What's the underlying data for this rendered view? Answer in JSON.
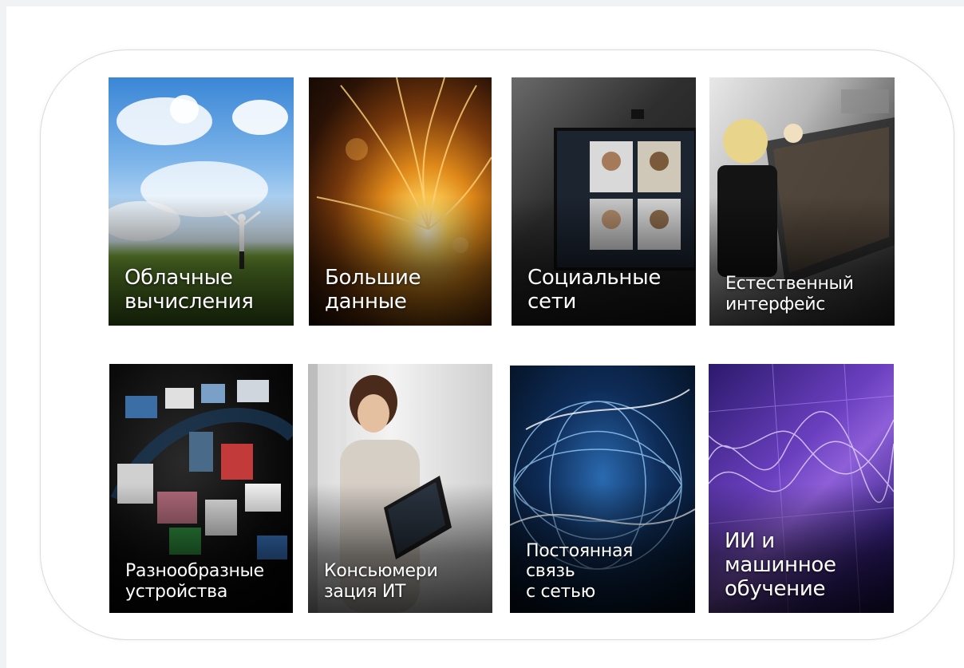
{
  "tiles": [
    {
      "line1": "Облачные",
      "line2": "вычисления"
    },
    {
      "line1": "Большие",
      "line2": "данные"
    },
    {
      "line1": "Социальные",
      "line2": "сети"
    },
    {
      "line1": "Естественный",
      "line2": "интерфейс"
    },
    {
      "line1": "Разнообразные",
      "line2": "устройства"
    },
    {
      "line1": "Консьюмери",
      "line2": "зация ИТ"
    },
    {
      "line1": "Постоянная",
      "line2": "связь",
      "line3": "с сетью"
    },
    {
      "line1": "ИИ и",
      "line2": "машинное",
      "line3": "обучение"
    }
  ],
  "colors": {
    "page_background": "#f1f2f3",
    "frame_border": "#d9dadc",
    "label_text": "#ffffff"
  }
}
